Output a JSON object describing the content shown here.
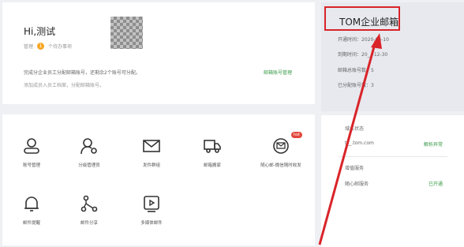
{
  "welcome": {
    "greeting": "Hi,测试",
    "role": "管理",
    "task_count": "1",
    "task_text": "个待办事项",
    "desc_line1": "完成分企业员工分配邮箱账号，还剩余2个账号可分配。",
    "desc_line2": "添加成员入员工档案，分配邮箱账号。",
    "assign_link": "邮箱账号管理"
  },
  "apps": [
    {
      "label": "账号管理",
      "icon": "user-icon"
    },
    {
      "label": "分级管理员",
      "icon": "admin-gear-icon"
    },
    {
      "label": "发件群组",
      "icon": "mail-icon"
    },
    {
      "label": "邮箱搬家",
      "icon": "truck-icon"
    },
    {
      "label": "随心邮-微信随时收发",
      "icon": "wechat-chat-icon",
      "badge": "hot"
    },
    {
      "label": "邮件提醒",
      "icon": "bell-icon"
    },
    {
      "label": "邮件分享",
      "icon": "share-icon"
    },
    {
      "label": "多媒体邮件",
      "icon": "video-icon"
    }
  ],
  "mail": {
    "title": "TOM企业邮箱",
    "open_date_label": "开通时间：",
    "open_date": "2020-06-10",
    "expire_label": "到期时间：",
    "expire_date": "20__-12-30",
    "total_label": "邮箱总账号数：",
    "total_value": "5",
    "assigned_label": "已分配账号数：",
    "assigned_value": "3"
  },
  "status": {
    "domain_section": "域名状态",
    "domain": "t__.tom.com",
    "domain_action": "解析异常",
    "service_section": "增值服务",
    "service_name": "随心邮服务",
    "service_status": "已开通"
  },
  "colors": {
    "accent_green": "#3a9a48",
    "highlight_red": "#d9242a",
    "badge_red": "#e2483b",
    "task_orange": "#f5a623"
  }
}
